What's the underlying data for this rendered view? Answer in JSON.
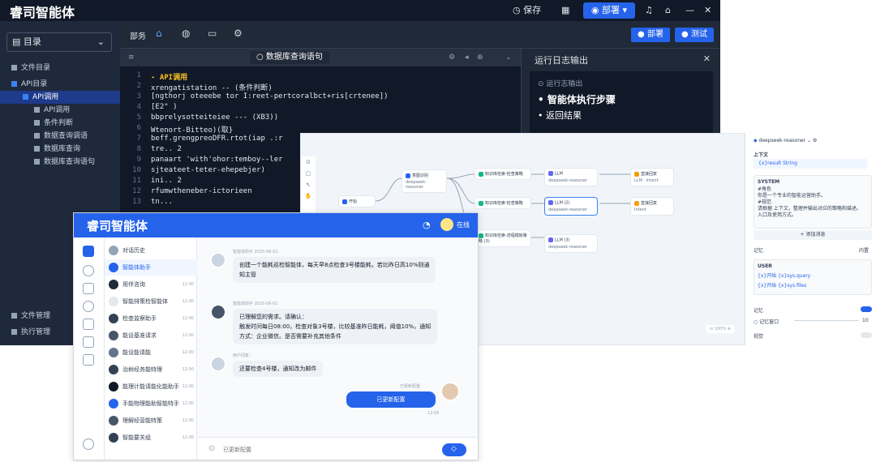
{
  "ide": {
    "brand": "睿司智能体",
    "save": "保存",
    "deploy_top": "部署",
    "sidebar_title": "目录",
    "tree": [
      {
        "label": "文件目录",
        "depth": 0,
        "sel": false
      },
      {
        "label": "API目录",
        "depth": 0,
        "sel": true
      },
      {
        "label": "API调用",
        "depth": 1,
        "sel": true
      },
      {
        "label": "API调用",
        "depth": 2,
        "sel": false
      },
      {
        "label": "条件判断",
        "depth": 2,
        "sel": false
      },
      {
        "label": "数据查询调语",
        "depth": 2,
        "sel": false
      },
      {
        "label": "数据库查询",
        "depth": 2,
        "sel": false
      },
      {
        "label": "数据库查询语句",
        "depth": 2,
        "sel": false
      },
      {
        "label": "文件管理",
        "depth": 0,
        "sel": false
      },
      {
        "label": "执行管理",
        "depth": 0,
        "sel": false
      }
    ],
    "tabs": [
      "部务"
    ],
    "deploy": "部署",
    "test": "测试",
    "editor_tab": "数据库查询语句",
    "code_lines": [
      "- API调用",
      "  xrengatistation -- (条件判断)",
      "  [ngthorj oteeebe tor  I:reet-pertcoralbct+ris[crtenee])",
      "   [E2\" )",
      "   bbprelysotteiteiee --- (XB3))",
      "     Wtenort-Bitteo)(取}",
      "      beff.grengpreoDFR.rtot(iap .:r",
      "      tre.. 2",
      "        panaart 'with'ohor:temboy--ler",
      "         sjteateet-teter-ehepebjer)",
      "       ini.. 2",
      "        rfumwtheneber-ictorieen",
      "      tn..."
    ],
    "log_title": "运行日志输出",
    "log_header": "运行志输出",
    "log_items": [
      "智能体执行步骤",
      "返回结果"
    ]
  },
  "canvas": {
    "nodes": [
      {
        "title": "开始",
        "sub": ""
      },
      {
        "title": "意图识别",
        "sub": "deepseek-reasoner"
      },
      {
        "title": "知识库检索-检查策略",
        "sub": ""
      },
      {
        "title": "LLM",
        "sub": "deepseek-reasoner"
      },
      {
        "title": "直接回复",
        "sub": "LLM · Intent"
      },
      {
        "title": "知识库检索-检查策略",
        "sub": ""
      },
      {
        "title": "LLM (2)",
        "sub": "deepseek-reasoner"
      },
      {
        "title": "直接回复",
        "sub": "Intent"
      },
      {
        "title": "知识库检索-流程模板策略 (3)",
        "sub": ""
      },
      {
        "title": "LLM (3)",
        "sub": "deepseek-reasoner"
      }
    ]
  },
  "config": {
    "model": "deepseek-reasoner",
    "context_label": "上下文",
    "context_val": "{x}result String",
    "system_label": "SYSTEM",
    "system_lines": [
      "#角色",
      "你是一个专业的智能运营助手。",
      "#规范",
      "请根据 上下文，整理并输出对应的策略和描述。",
      "入口及使用方式。"
    ],
    "add_msg": "+ 添加消息",
    "memory_label": "记忆",
    "memory_val": "内置",
    "user_label": "USER",
    "user_vars": [
      "{x}开始 {x}sys.query",
      "{x}开始 {x}sys.files"
    ],
    "memory2": "记忆",
    "window": "记忆窗口",
    "window_val": "10",
    "vision": "视觉"
  },
  "chat": {
    "title": "睿司智能体",
    "online": "在线",
    "list": [
      {
        "label": "对话历史",
        "time": ""
      },
      {
        "label": "智能体助手",
        "time": ""
      },
      {
        "label": "用伴咨询",
        "time": "12:00"
      },
      {
        "label": "智能排策检智能体",
        "time": "12:00"
      },
      {
        "label": "检查监察助手",
        "time": "12:00"
      },
      {
        "label": "能设基准请求",
        "time": "12:00"
      },
      {
        "label": "能设能请能",
        "time": "12:00"
      },
      {
        "label": "治树经务能特理",
        "time": "12:00"
      },
      {
        "label": "能理计能请能化能助手",
        "time": "12:00"
      },
      {
        "label": "手能物理能助智能特手",
        "time": "12:00"
      },
      {
        "label": "理解经营能特策",
        "time": "12:00"
      },
      {
        "label": "智能要关组",
        "time": "12:00"
      }
    ],
    "messages": [
      {
        "meta": "智能体助手 2025-06-01",
        "text": [
          "创建一个能耗巡检智能体，每天早8点检查3号楼能耗，若比昨日高10%则通",
          "知主管"
        ]
      },
      {
        "meta": "智能体助手 2025-06-01",
        "text": [
          "已理解您的需求。请确认：",
          "触发时间每日08:00，检查对象3号楼，比较基准昨日能耗，阈值10%，通知",
          "方式：企业微信。是否需要补充其他条件"
        ]
      },
      {
        "meta": "用户回复：",
        "text": [
          "还要检查4号楼，通知改为邮件"
        ]
      }
    ],
    "user_meta": "已更新配置",
    "user_reply": "已更新配置",
    "user_time": "12:05",
    "input_placeholder": "已更新配置"
  }
}
